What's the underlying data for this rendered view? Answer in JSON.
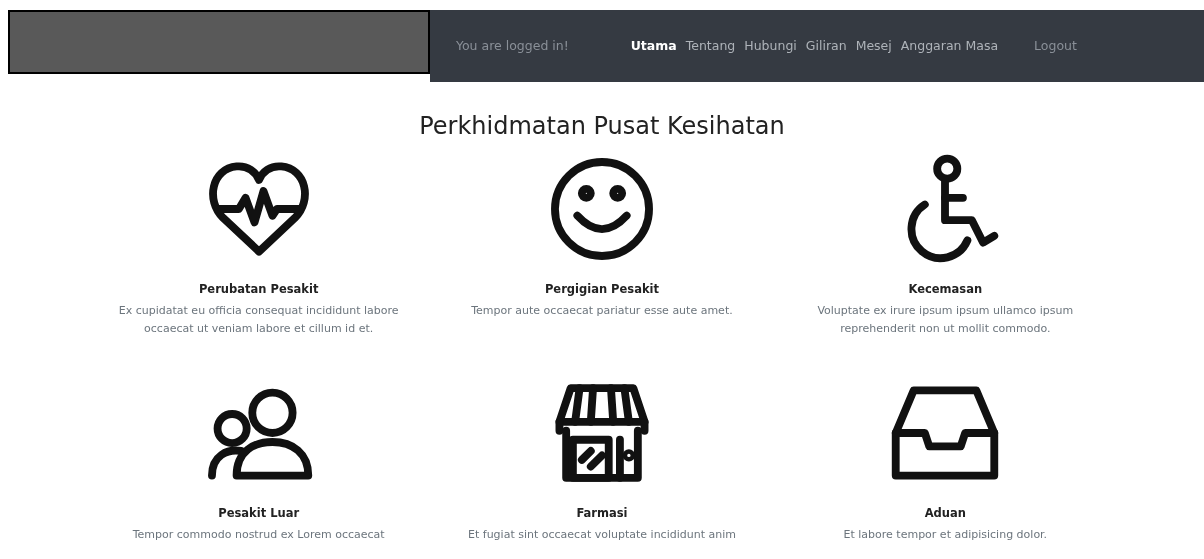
{
  "navbar": {
    "status_text": "You are logged in!",
    "links": [
      {
        "label": "Utama",
        "selected": true
      },
      {
        "label": "Tentang",
        "selected": false
      },
      {
        "label": "Hubungi",
        "selected": false
      },
      {
        "label": "Giliran",
        "selected": false
      },
      {
        "label": "Mesej",
        "selected": false
      },
      {
        "label": "Anggaran Masa",
        "selected": false
      }
    ],
    "logout": "Logout"
  },
  "heading": "Perkhidmatan Pusat Kesihatan",
  "services": [
    {
      "kind": "heartbeat",
      "title": "Perubatan Pesakit",
      "description": "Ex cupidatat eu officia consequat incididunt labore occaecat ut veniam labore et cillum id et."
    },
    {
      "kind": "smiley",
      "title": "Pergigian Pesakit",
      "description": "Tempor aute occaecat pariatur esse aute amet."
    },
    {
      "kind": "wheelchair",
      "title": "Kecemasan",
      "description": "Voluptate ex irure ipsum ipsum ullamco ipsum reprehenderit non ut mollit commodo."
    },
    {
      "kind": "people",
      "title": "Pesakit Luar",
      "description": "Tempor commodo nostrud ex Lorem occaecat"
    },
    {
      "kind": "shop",
      "title": "Farmasi",
      "description": "Et fugiat sint occaecat voluptate incididunt anim"
    },
    {
      "kind": "inbox",
      "title": "Aduan",
      "description": "Et labore tempor et adipisicing dolor."
    }
  ]
}
